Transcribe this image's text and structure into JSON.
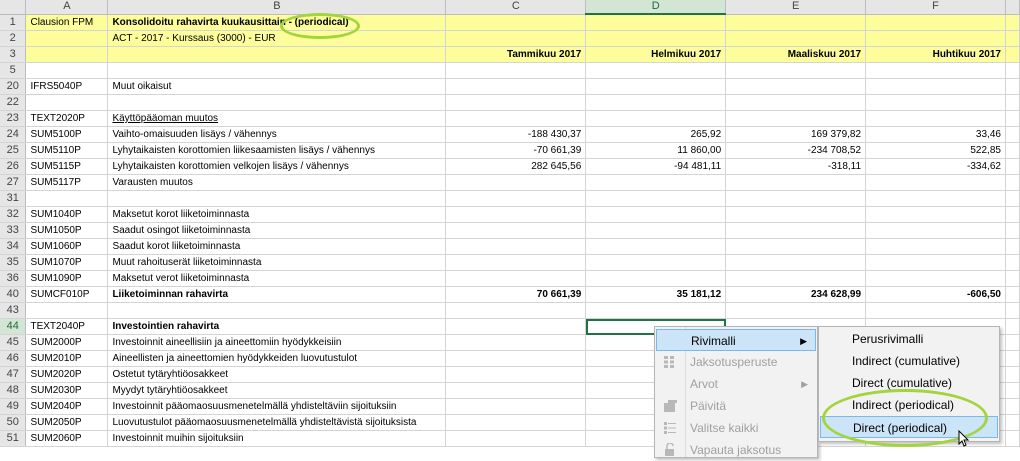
{
  "columns": [
    "A",
    "B",
    "C",
    "D",
    "E",
    "F"
  ],
  "header": {
    "a1": "Clausion FPM",
    "title": "Konsolidoitu rahavirta kuukausittain - (periodical)",
    "subtitle": "ACT - 2017 - Kurssaus (3000) - EUR",
    "months": [
      "Tammikuu 2017",
      "Helmikuu 2017",
      "Maaliskuu 2017",
      "Huhtikuu 2017"
    ]
  },
  "rows": [
    {
      "n": "1",
      "a": "Clausion FPM",
      "b": "Konsolidoitu rahavirta kuukausittain - (periodical)",
      "c": "",
      "d": "",
      "e": "",
      "f": ""
    },
    {
      "n": "2",
      "a": "",
      "b": "ACT - 2017 - Kurssaus (3000) - EUR",
      "c": "",
      "d": "",
      "e": "",
      "f": ""
    },
    {
      "n": "3",
      "a": "",
      "b": "",
      "c": "Tammikuu 2017",
      "d": "Helmikuu 2017",
      "e": "Maaliskuu 2017",
      "f": "Huhtikuu 2017"
    },
    {
      "n": "5",
      "a": "",
      "b": "",
      "c": "",
      "d": "",
      "e": "",
      "f": ""
    },
    {
      "n": "20",
      "a": "IFRS5040P",
      "b": "Muut oikaisut",
      "c": "",
      "d": "",
      "e": "",
      "f": ""
    },
    {
      "n": "22",
      "a": "",
      "b": "",
      "c": "",
      "d": "",
      "e": "",
      "f": ""
    },
    {
      "n": "23",
      "a": "TEXT2020P",
      "b": "Käyttöpääoman muutos",
      "c": "",
      "d": "",
      "e": "",
      "f": ""
    },
    {
      "n": "24",
      "a": "SUM5100P",
      "b": "Vaihto-omaisuuden lisäys / vähennys",
      "c": "-188 430,37",
      "d": "265,92",
      "e": "169 379,82",
      "f": "33,46"
    },
    {
      "n": "25",
      "a": "SUM5110P",
      "b": "Lyhytaikaisten korottomien liikesaamisten lisäys / vähennys",
      "c": "-70 661,39",
      "d": "11 860,00",
      "e": "-234 708,52",
      "f": "522,85"
    },
    {
      "n": "26",
      "a": "SUM5115P",
      "b": "Lyhytaikaisten korottomien velkojen lisäys / vähennys",
      "c": "282 645,56",
      "d": "-94 481,11",
      "e": "-318,11",
      "f": "-334,62"
    },
    {
      "n": "27",
      "a": "SUM5117P",
      "b": "Varausten muutos",
      "c": "",
      "d": "",
      "e": "",
      "f": ""
    },
    {
      "n": "31",
      "a": "",
      "b": "",
      "c": "",
      "d": "",
      "e": "",
      "f": ""
    },
    {
      "n": "32",
      "a": "SUM1040P",
      "b": "Maksetut korot liiketoiminnasta",
      "c": "",
      "d": "",
      "e": "",
      "f": ""
    },
    {
      "n": "33",
      "a": "SUM1050P",
      "b": "Saadut osingot liiketoiminnasta",
      "c": "",
      "d": "",
      "e": "",
      "f": ""
    },
    {
      "n": "34",
      "a": "SUM1060P",
      "b": "Saadut korot liiketoiminnasta",
      "c": "",
      "d": "",
      "e": "",
      "f": ""
    },
    {
      "n": "35",
      "a": "SUM1070P",
      "b": "Muut rahoituserät liiketoiminnasta",
      "c": "",
      "d": "",
      "e": "",
      "f": ""
    },
    {
      "n": "36",
      "a": "SUM1090P",
      "b": "Maksetut verot liiketoiminnasta",
      "c": "",
      "d": "",
      "e": "",
      "f": ""
    },
    {
      "n": "40",
      "a": "SUMCF010P",
      "b": "Liiketoiminnan rahavirta",
      "c": "70 661,39",
      "d": "35 181,12",
      "e": "234 628,99",
      "f": "-606,50"
    },
    {
      "n": "43",
      "a": "",
      "b": "",
      "c": "",
      "d": "",
      "e": "",
      "f": ""
    },
    {
      "n": "44",
      "a": "TEXT2040P",
      "b": "Investointien rahavirta",
      "c": "",
      "d": "",
      "e": "",
      "f": ""
    },
    {
      "n": "45",
      "a": "SUM2000P",
      "b": "Investoinnit aineellisiin ja aineettomiin hyödykkeisiin",
      "c": "",
      "d": "",
      "e": "",
      "f": ""
    },
    {
      "n": "46",
      "a": "SUM2010P",
      "b": "Aineellisten ja aineettomien hyödykkeiden luovutustulot",
      "c": "",
      "d": "",
      "e": "",
      "f": ""
    },
    {
      "n": "47",
      "a": "SUM2020P",
      "b": "Ostetut tytäryhtiöosakkeet",
      "c": "",
      "d": "",
      "e": "",
      "f": ""
    },
    {
      "n": "48",
      "a": "SUM2030P",
      "b": "Myydyt tytäryhtiöosakkeet",
      "c": "",
      "d": "",
      "e": "",
      "f": ""
    },
    {
      "n": "49",
      "a": "SUM2040P",
      "b": "Investoinnit pääomaosuusmenetelmällä yhdisteltäviin sijoituksiin",
      "c": "",
      "d": "",
      "e": "",
      "f": ""
    },
    {
      "n": "50",
      "a": "SUM2050P",
      "b": "Luovutustulot pääomaosuusmenetelmällä yhdisteltävistä sijoituksista",
      "c": "",
      "d": "",
      "e": "",
      "f": ""
    },
    {
      "n": "51",
      "a": "SUM2060P",
      "b": "Investoinnit muihin sijoituksiin",
      "c": "",
      "d": "",
      "e": "",
      "f": ""
    }
  ],
  "context_menu": {
    "items": [
      {
        "label": "Rivimalli",
        "icon": "none",
        "disabled": false,
        "submenu": true
      },
      {
        "label": "Jaksotusperuste",
        "icon": "grid-icon",
        "disabled": true,
        "submenu": false
      },
      {
        "label": "Arvot",
        "icon": "none",
        "disabled": true,
        "submenu": true
      },
      {
        "label": "Päivitä",
        "icon": "refresh-icon",
        "disabled": true,
        "submenu": false
      },
      {
        "label": "Valitse kaikki",
        "icon": "checklist-icon",
        "disabled": true,
        "submenu": false
      },
      {
        "label": "Vapauta jaksotus",
        "icon": "unlock-icon",
        "disabled": true,
        "submenu": false
      }
    ]
  },
  "submenu": {
    "items": [
      "Perusrivimalli",
      "Indirect (cumulative)",
      "Direct (cumulative)",
      "Indirect (periodical)",
      "Direct (periodical)"
    ],
    "hovered": "Direct (periodical)"
  },
  "colors": {
    "highlight": "#fdfd9b",
    "ellipse": "#a4d43d",
    "hover": "#cce4f7",
    "selection": "#217346"
  }
}
